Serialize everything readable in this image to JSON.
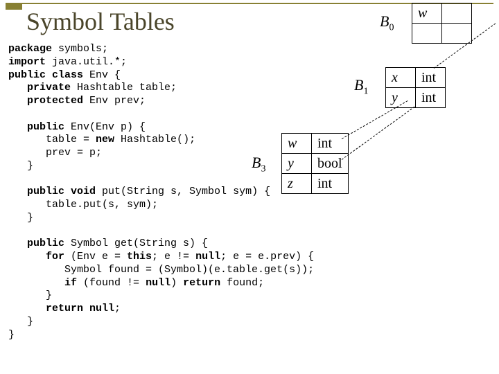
{
  "title": "Symbol Tables",
  "code": {
    "l1a": "package",
    "l1b": " symbols;",
    "l2a": "import",
    "l2b": " java.util.*;",
    "l3a": "public class",
    "l3b": " Env {",
    "l4a": "   private",
    "l4b": " Hashtable table;",
    "l5a": "   protected",
    "l5b": " Env prev;",
    "l6a": "   public",
    "l6b": " Env(Env p) {",
    "l7": "      table = ",
    "l7a": "new",
    "l7b": " Hashtable();",
    "l8": "      prev = p;",
    "l9": "   }",
    "l10a": "   public void",
    "l10b": " put(String s, Symbol sym) {",
    "l11": "      table.put(s, sym);",
    "l12": "   }",
    "l13a": "   public",
    "l13b": " Symbol get(String s) {",
    "l14a": "      for",
    "l14b": " (Env e = ",
    "l14c": "this",
    "l14d": "; e != ",
    "l14e": "null",
    "l14f": "; e = e.prev) {",
    "l15": "         Symbol found = (Symbol)(e.table.get(s));",
    "l16a": "         if",
    "l16b": " (found != ",
    "l16c": "null",
    "l16d": ") ",
    "l16e": "return",
    "l16f": " found;",
    "l17": "      }",
    "l18a": "      return null",
    "l18b": ";",
    "l19": "   }",
    "l20": "}"
  },
  "labels": {
    "b0": "B",
    "b0s": "0",
    "b1": "B",
    "b1s": "1",
    "b3": "B",
    "b3s": "3"
  },
  "t0": {
    "r1c1": "w",
    "r1c2": ""
  },
  "t1": {
    "r1c1": "x",
    "r1c2": "int",
    "r2c1": "y",
    "r2c2": "int"
  },
  "t3": {
    "r1c1": "w",
    "r1c2": "int",
    "r2c1": "y",
    "r2c2": "bool",
    "r3c1": "z",
    "r3c2": "int"
  }
}
